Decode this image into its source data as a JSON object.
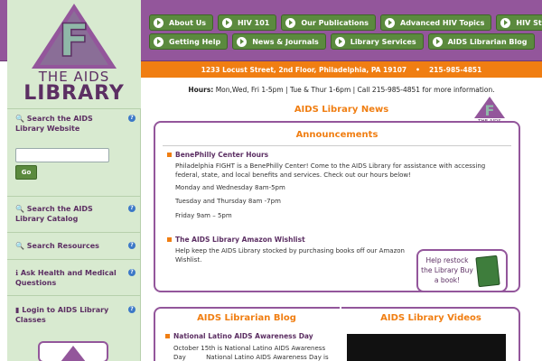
{
  "logo": {
    "letter": "F",
    "line1": "THE AIDS",
    "line2": "LIBRARY"
  },
  "nav": {
    "row1": [
      "About Us",
      "HIV 101",
      "Our Publications",
      "Advanced HIV Topics",
      "HIV Statistics"
    ],
    "row2": [
      "Getting Help",
      "News & Journals",
      "Library Services",
      "AIDS Librarian Blog"
    ]
  },
  "address_bar": {
    "address": "1233 Locust Street, 2nd Floor, Philadelphia, PA 19107",
    "bullet": "•",
    "phone": "215-985-4851"
  },
  "hours": {
    "label": "Hours:",
    "text": "Mon,Wed, Fri 1-5pm | Tue & Thur 1-6pm | Call 215-985-4851 for more information."
  },
  "sidebar": {
    "search_website": "Search the AIDS Library Website",
    "go_label": "Go",
    "search_catalog": "Search the AIDS Library Catalog",
    "search_resources": "Search Resources",
    "ask_health": "Ask Health and Medical Questions",
    "login_classes": "Login to AIDS Library Classes",
    "help_glyph": "?"
  },
  "news": {
    "title": "AIDS Library News",
    "announcements_title": "Announcements",
    "items": [
      {
        "title": "BenePhilly Center Hours",
        "paragraphs": [
          "Philadelphia FIGHT is a BenePhilly Center! Come to the AIDS Library for assistance with accessing federal, state, and local benefits and services. Check out our hours below!",
          "Monday and Wednesday 8am-5pm",
          "Tuesday and Thursday 8am -7pm",
          "Friday 9am – 5pm"
        ]
      },
      {
        "title": "The AIDS Library Amazon Wishlist",
        "paragraphs": [
          "Help keep the AIDS Library stocked by purchasing books off our Amazon Wishlist."
        ]
      }
    ],
    "restock": "Help restock the Library Buy a book!"
  },
  "blog": {
    "title": "AIDS Librarian Blog",
    "post_title": "National Latino AIDS Awareness Day",
    "post_line1": "October 15th is National Latino AIDS Awareness",
    "post_line2": "Day          National Latino AIDS Awareness Day is"
  },
  "videos": {
    "title": "AIDS Library Videos"
  },
  "colors": {
    "purple": "#93569b",
    "green": "#5b8a3e",
    "orange": "#f07e12",
    "sidebar": "#d8ead0"
  }
}
